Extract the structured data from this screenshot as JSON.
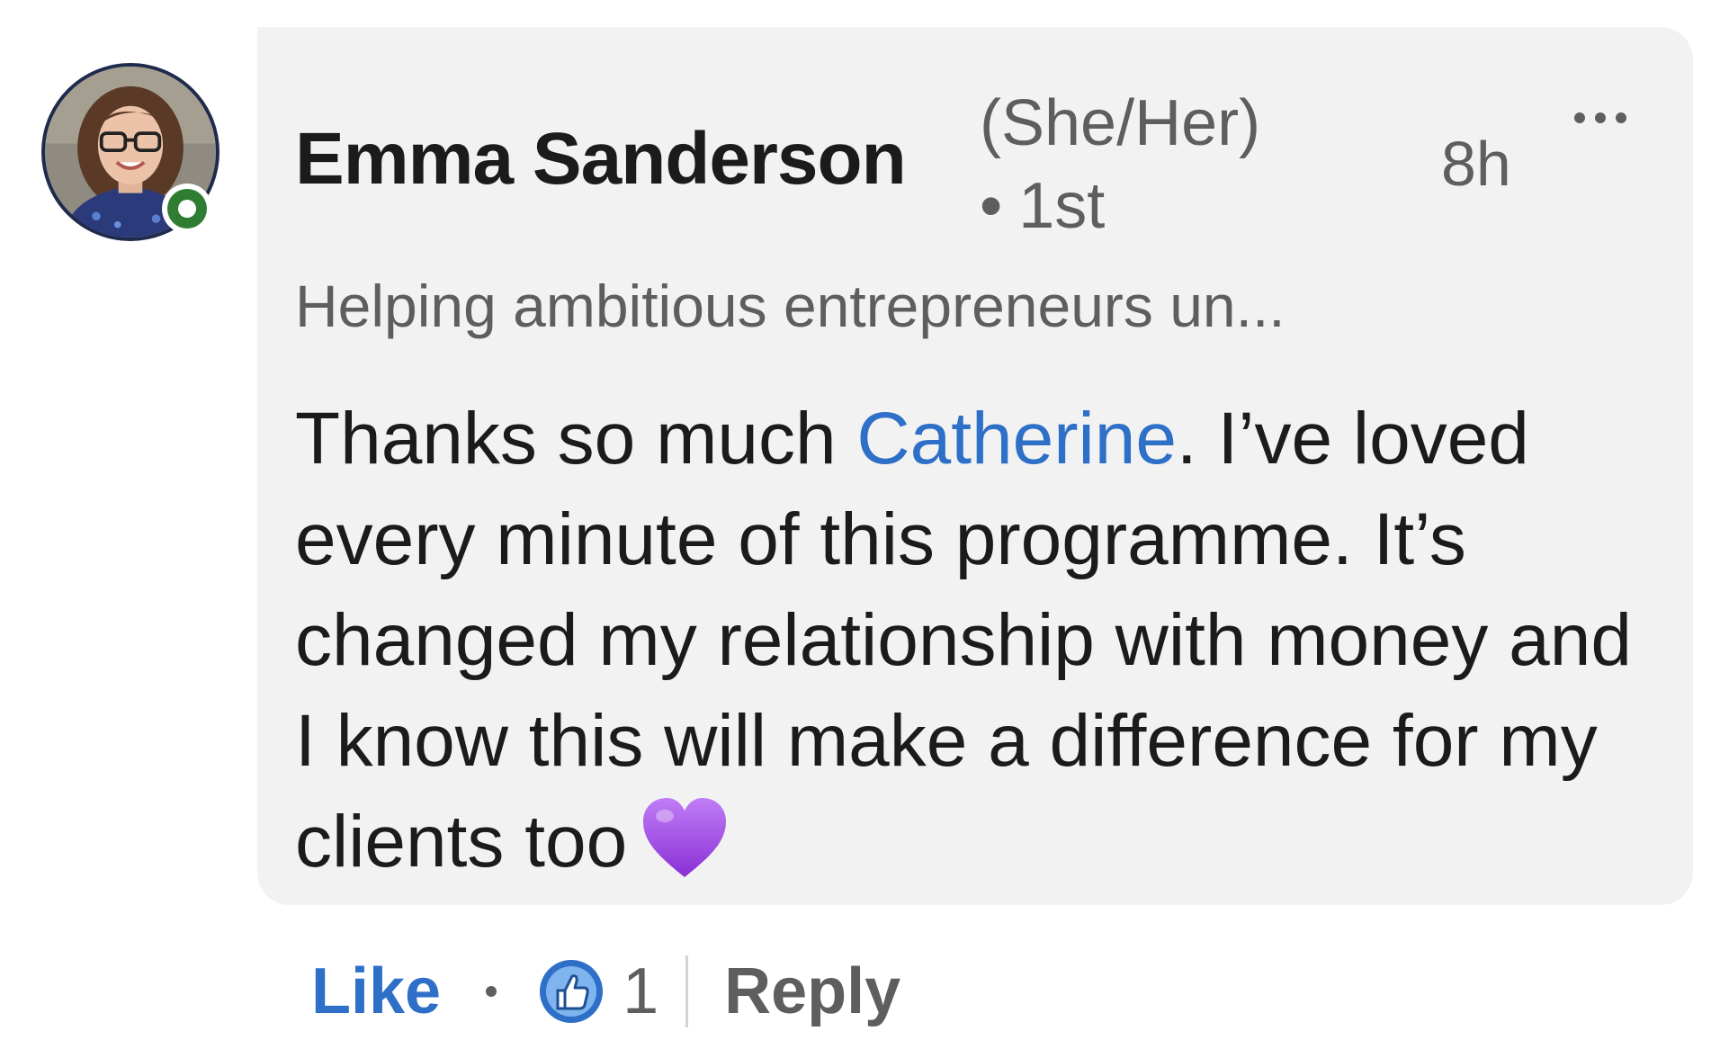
{
  "avatar": {
    "icon": "profile-photo",
    "presence": "online"
  },
  "comment": {
    "author": "Emma Sanderson",
    "pronouns": "(She/Her)",
    "degree_separator": "•",
    "degree": "1st",
    "timestamp": "8h",
    "more_icon": "ellipsis-icon",
    "headline": "Helping ambitious entrepreneurs un...",
    "text_before_mention": "Thanks so much ",
    "mention": "Catherine",
    "text_after_mention": ". I’ve loved every minute of this programme. It’s changed my relationship with money and I know this will make a difference for my clients too",
    "emoji": "purple-heart-icon"
  },
  "actions": {
    "like_label": "Like",
    "separator": "•",
    "reaction_icon": "thumbs-up-icon",
    "reaction_count": "1",
    "reply_label": "Reply"
  },
  "colors": {
    "accent": "#2e6fc7",
    "bubble_bg": "#f2f2f2",
    "presence": "#2e7d32",
    "muted_text": "#5e5e5e",
    "heart": "#a049e6"
  }
}
